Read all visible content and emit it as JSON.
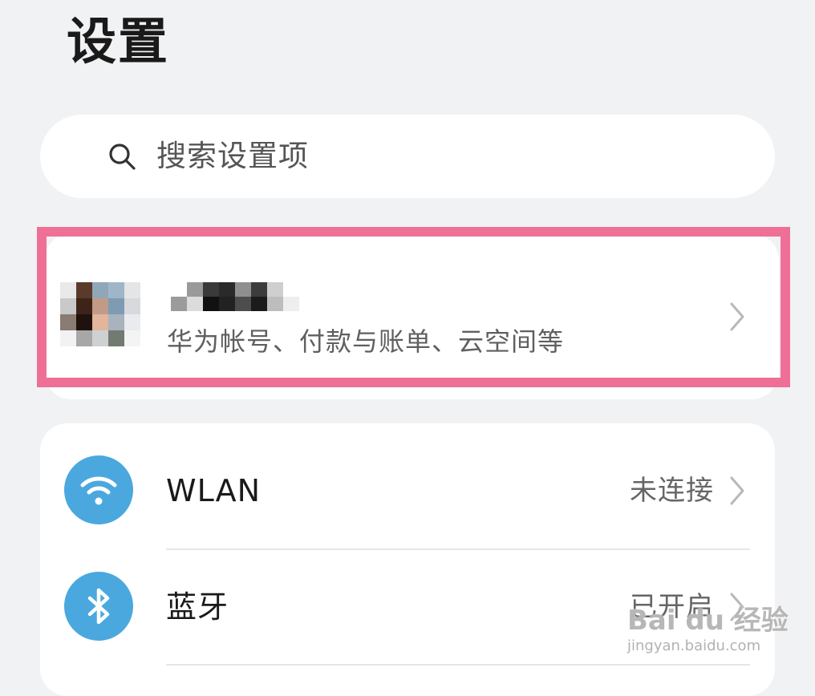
{
  "header": {
    "title": "设置"
  },
  "search": {
    "placeholder": "搜索设置项",
    "icon": "search-icon"
  },
  "account": {
    "subtitle": "华为帐号、付款与账单、云空间等",
    "name_redacted": true,
    "avatar_redacted": true,
    "highlight_color": "#ef7096"
  },
  "settings": {
    "items": [
      {
        "label": "WLAN",
        "value": "未连接",
        "icon": "wifi-icon",
        "icon_color": "#4aa8df"
      },
      {
        "label": "蓝牙",
        "value": "已开启",
        "icon": "bluetooth-icon",
        "icon_color": "#4aa8df"
      }
    ]
  },
  "watermark": {
    "main": "Bai du 经验",
    "sub": "jingyan.baidu.com"
  }
}
